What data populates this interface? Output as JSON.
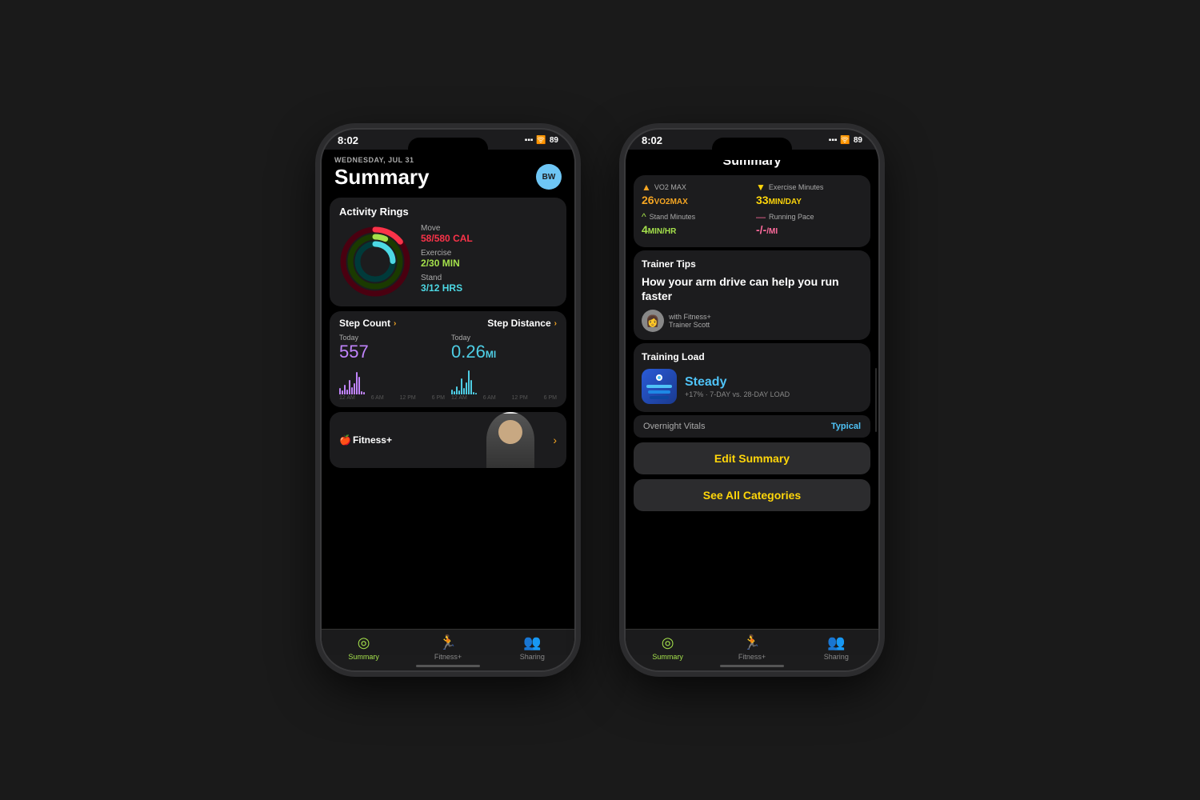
{
  "phone1": {
    "status": {
      "time": "8:02",
      "battery": "89"
    },
    "header": {
      "date": "WEDNESDAY, JUL 31",
      "title": "Summary",
      "avatar": "BW"
    },
    "activity": {
      "section_title": "Activity Rings",
      "move_label": "Move",
      "move_value": "58",
      "move_goal": "580",
      "move_unit": "CAL",
      "exercise_label": "Exercise",
      "exercise_value": "2",
      "exercise_goal": "30",
      "exercise_unit": "MIN",
      "stand_label": "Stand",
      "stand_value": "3",
      "stand_goal": "12",
      "stand_unit": "HRS"
    },
    "steps": {
      "step_count_label": "Step Count",
      "step_distance_label": "Step Distance",
      "today_label": "Today",
      "step_value": "557",
      "distance_value": "0.26",
      "distance_unit": "MI"
    },
    "chart_labels": [
      "12 AM",
      "6 AM",
      "12 PM",
      "6 PM"
    ],
    "fitness": {
      "label": "Fitness+"
    },
    "tabs": {
      "summary": "Summary",
      "fitness": "Fitness+",
      "sharing": "Sharing"
    }
  },
  "phone2": {
    "status": {
      "time": "8:02",
      "battery": "89"
    },
    "header": {
      "title": "Summary"
    },
    "metrics": [
      {
        "name": "VO2 MAX",
        "value": "26",
        "unit": "VO2MAX",
        "color": "orange",
        "icon": "▲"
      },
      {
        "name": "Exercise Minutes",
        "value": "33",
        "unit": "MIN/DAY",
        "color": "yellow",
        "icon": "▼"
      },
      {
        "name": "Stand Minutes",
        "value": "4",
        "unit": "MIN/HR",
        "color": "green",
        "icon": "^"
      },
      {
        "name": "Running Pace",
        "value": "-/-",
        "unit": "/MI",
        "color": "pink",
        "icon": "—"
      }
    ],
    "trainer": {
      "section_title": "Trainer Tips",
      "tip": "How your arm drive can help you run faster",
      "trainer_label": "with Fitness+\nTrainer Scott"
    },
    "training": {
      "section_title": "Training Load",
      "status": "Steady",
      "sub": "+17% · 7-DAY vs. 28-DAY LOAD"
    },
    "vitals": {
      "label": "Overnight Vitals",
      "value": "Typical"
    },
    "buttons": {
      "edit": "Edit Summary",
      "all": "See All Categories"
    },
    "tabs": {
      "summary": "Summary",
      "fitness": "Fitness+",
      "sharing": "Sharing"
    }
  }
}
